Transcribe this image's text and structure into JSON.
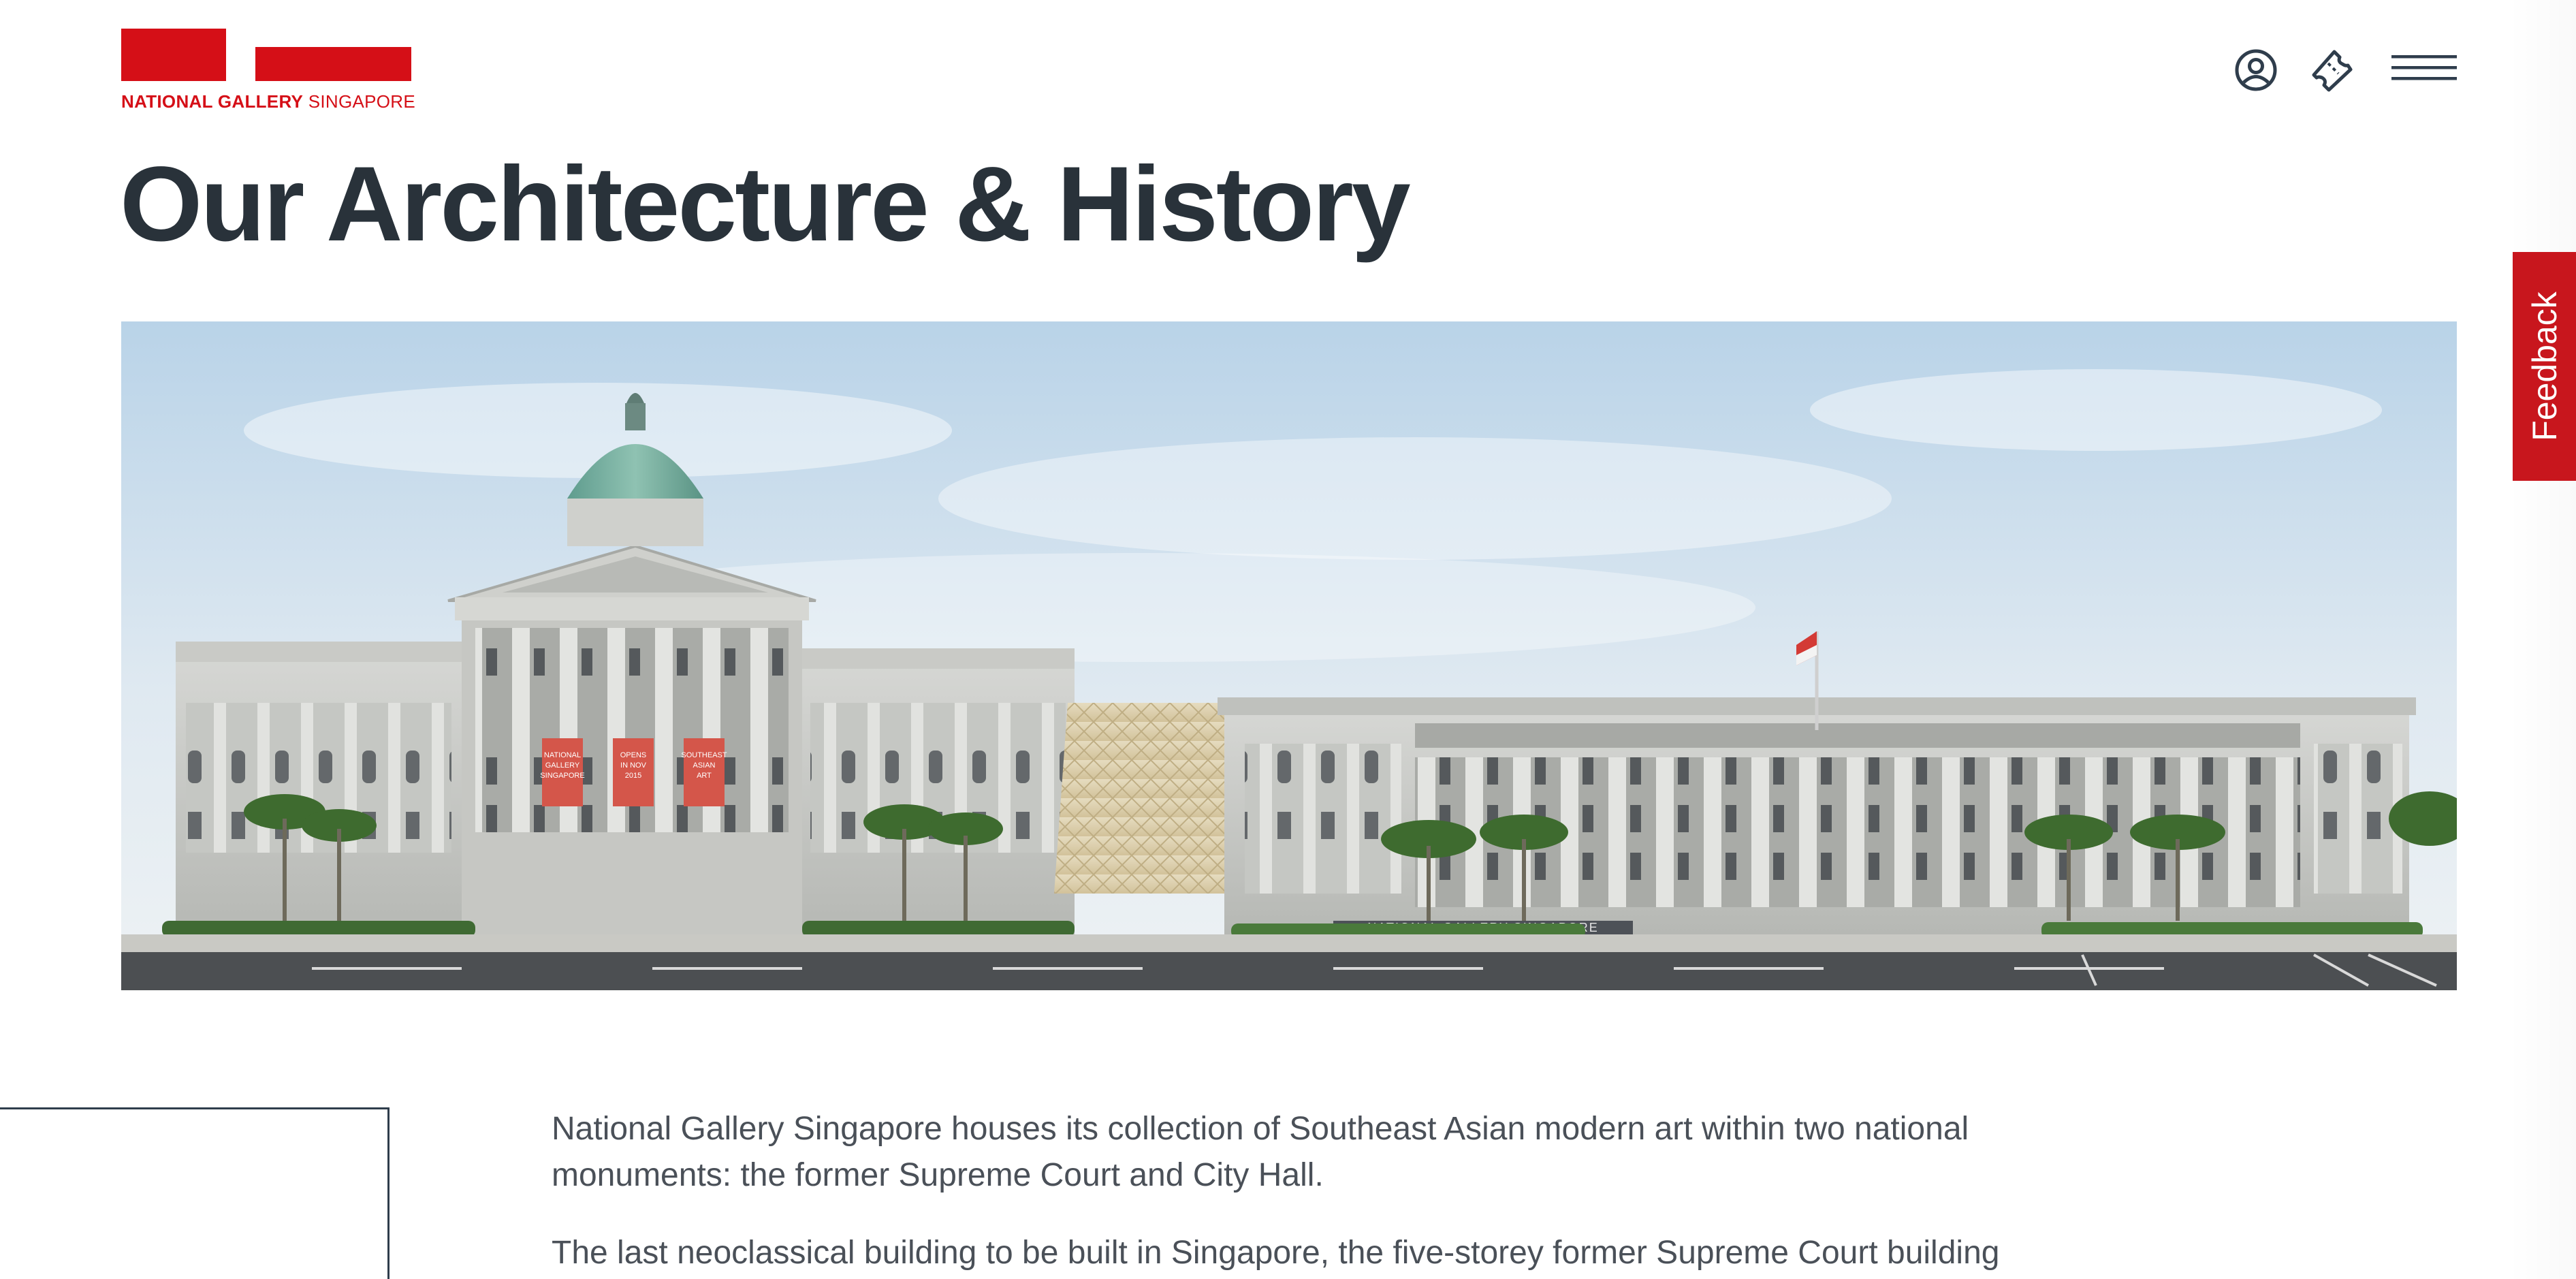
{
  "header": {
    "logo": {
      "bold_text": "NATIONAL GALLERY",
      "light_text": " SINGAPORE",
      "brand_color": "#d50f17"
    },
    "icons": [
      "account-icon",
      "ticket-icon",
      "menu-icon"
    ]
  },
  "page": {
    "title": "Our Architecture & History"
  },
  "hero": {
    "banners": [
      [
        "NATIONAL",
        "GALLERY",
        "SINGAPORE"
      ],
      [
        "OPENS",
        "IN NOV",
        "2015"
      ],
      [
        "SOUTHEAST",
        "ASIAN",
        "ART"
      ]
    ],
    "building_sign": "NATIONAL GALLERY SINGAPORE"
  },
  "feedback": {
    "label": "Feedback",
    "color": "#c8161d"
  },
  "content": {
    "paragraphs": [
      "National Gallery Singapore houses its collection of Southeast Asian modern art within two national monuments: the former Supreme Court and City Hall.",
      "The last neoclassical building to be built in Singapore, the five-storey former Supreme Court building"
    ]
  }
}
